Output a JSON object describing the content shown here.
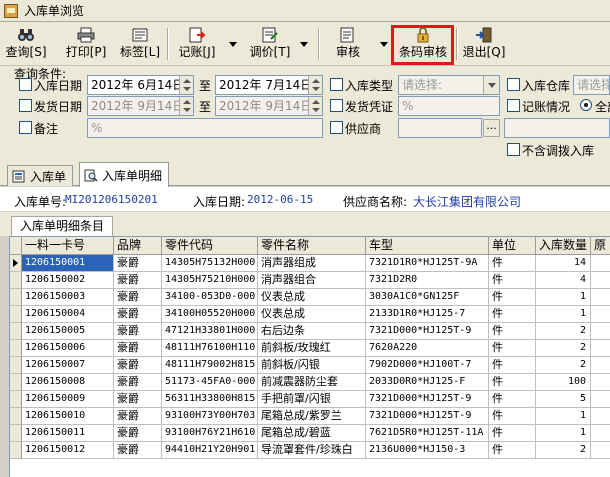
{
  "window": {
    "title": "入库单浏览"
  },
  "toolbar": {
    "query": "查询[S]",
    "print": "打印[P]",
    "label": "标签[L]",
    "post": "记账[J]",
    "price": "调价[T]",
    "audit": "审核",
    "barcode_audit": "条码审核",
    "exit": "退出[Q]"
  },
  "query": {
    "title": "查询条件:",
    "in_date_label": "入库日期",
    "in_date_from": "2012年 6月14日",
    "to1": "至",
    "in_date_to": "2012年 7月14日",
    "in_type_label": "入库类型",
    "in_type_placeholder": "请选择:",
    "in_warehouse_label": "入库仓库",
    "in_warehouse_placeholder": "请选择",
    "ship_date_label": "发货日期",
    "ship_date_from": "2012年 9月14日",
    "to2": "至",
    "ship_date_to": "2012年 9月14日",
    "ship_voucher_label": "发货凭证",
    "ship_voucher_value": "%",
    "post_status_label": "记账情况",
    "post_status_option": "全部",
    "remark_label": "备注",
    "remark_value": "%",
    "supplier_label": "供应商",
    "supplier_ellipsis": "...",
    "exclude_transfer_label": "不含调拨入库"
  },
  "tabs": [
    {
      "label": "入库单"
    },
    {
      "label": "入库单明细"
    }
  ],
  "info": {
    "order_no_label": "入库单号:",
    "order_no": "MI201206150201",
    "date_label": "入库日期:",
    "date": "2012-06-15",
    "supplier_label": "供应商名称:",
    "supplier": "大长江集团有限公司"
  },
  "subtab": {
    "label": "入库单明细条目"
  },
  "grid": {
    "columns": [
      "一料一卡号",
      "品牌",
      "零件代码",
      "零件名称",
      "车型",
      "单位",
      "入库数量",
      "原"
    ],
    "rows": [
      [
        "1206150001",
        "豪爵",
        "14305H75132H000",
        "消声器组成",
        "7321D1R0*HJ125T-9A",
        "件",
        "14"
      ],
      [
        "1206150002",
        "豪爵",
        "14305H75210H000",
        "消声器组合",
        "7321D2R0",
        "件",
        "4"
      ],
      [
        "1206150003",
        "豪爵",
        "34100-053D0-000",
        "仪表总成",
        "3030A1C0*GN125F",
        "件",
        "1"
      ],
      [
        "1206150004",
        "豪爵",
        "34100H05520H000",
        "仪表总成",
        "2133D1R0*HJ125-7",
        "件",
        "1"
      ],
      [
        "1206150005",
        "豪爵",
        "47121H33801H000",
        "右后边条",
        "7321D000*HJ125T-9",
        "件",
        "2"
      ],
      [
        "1206150006",
        "豪爵",
        "48111H76100H110",
        "前斜板/玫瑰红",
        "7620A220",
        "件",
        "2"
      ],
      [
        "1206150007",
        "豪爵",
        "48111H79002H815",
        "前斜板/闪银",
        "7902D000*HJ100T-7",
        "件",
        "2"
      ],
      [
        "1206150008",
        "豪爵",
        "51173-45FA0-000",
        "前减震器防尘套",
        "2033D0R0*HJ125-F",
        "件",
        "100"
      ],
      [
        "1206150009",
        "豪爵",
        "56311H33800H815",
        "手把前罩/闪银",
        "7321D000*HJ125T-9",
        "件",
        "5"
      ],
      [
        "1206150010",
        "豪爵",
        "93100H73Y00H703",
        "尾箱总成/紫罗兰",
        "7321D000*HJ125T-9",
        "件",
        "1"
      ],
      [
        "1206150011",
        "豪爵",
        "93100H76Y21H610",
        "尾箱总成/碧蓝",
        "7621D5R0*HJ125T-11A",
        "件",
        "1"
      ],
      [
        "1206150012",
        "豪爵",
        "94410H21Y20H901",
        "导流罩套件/珍珠白",
        "2136U000*HJ150-3",
        "件",
        "2"
      ]
    ]
  }
}
